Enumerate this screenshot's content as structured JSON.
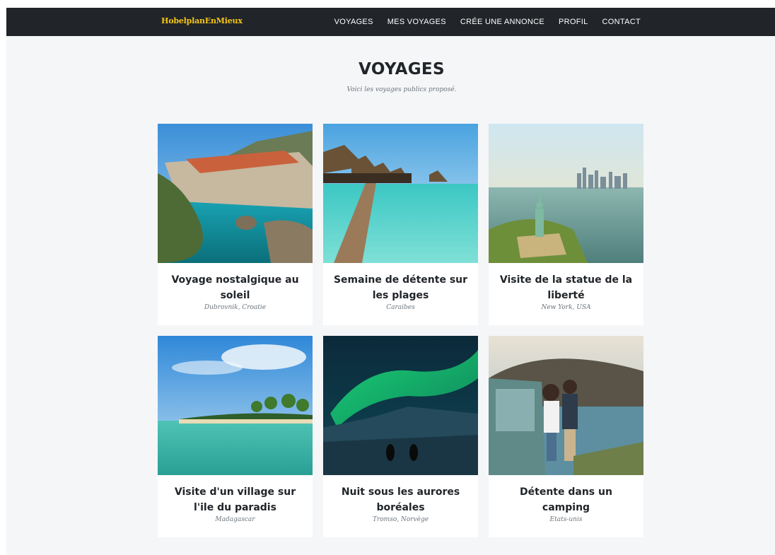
{
  "brand": "HobelplanEnMieux",
  "nav": [
    "VOYAGES",
    "MES VOYAGES",
    "CRÉE UNE ANNONCE",
    "PROFIL",
    "CONTACT"
  ],
  "page": {
    "title": "VOYAGES",
    "subtitle": "Voici les voyages publics proposé."
  },
  "trips": [
    {
      "title": "Voyage nostalgique au soleil",
      "location": "Dubrovnik, Croatie",
      "image": "dubrovnik-coast-photo"
    },
    {
      "title": "Semaine de détente sur les plages",
      "location": "Caraibes",
      "image": "overwater-bungalows-photo"
    },
    {
      "title": "Visite de la statue de la liberté",
      "location": "New York, USA",
      "image": "statue-of-liberty-photo"
    },
    {
      "title": "Visite d'un village sur l'ile du paradis",
      "location": "Madagascar",
      "image": "tropical-island-beach-photo"
    },
    {
      "title": "Nuit sous les aurores boréales",
      "location": "Tromso, Norvège",
      "image": "northern-lights-photo"
    },
    {
      "title": "Détente dans un camping",
      "location": "Etats-unis",
      "image": "couple-by-car-photo"
    }
  ]
}
